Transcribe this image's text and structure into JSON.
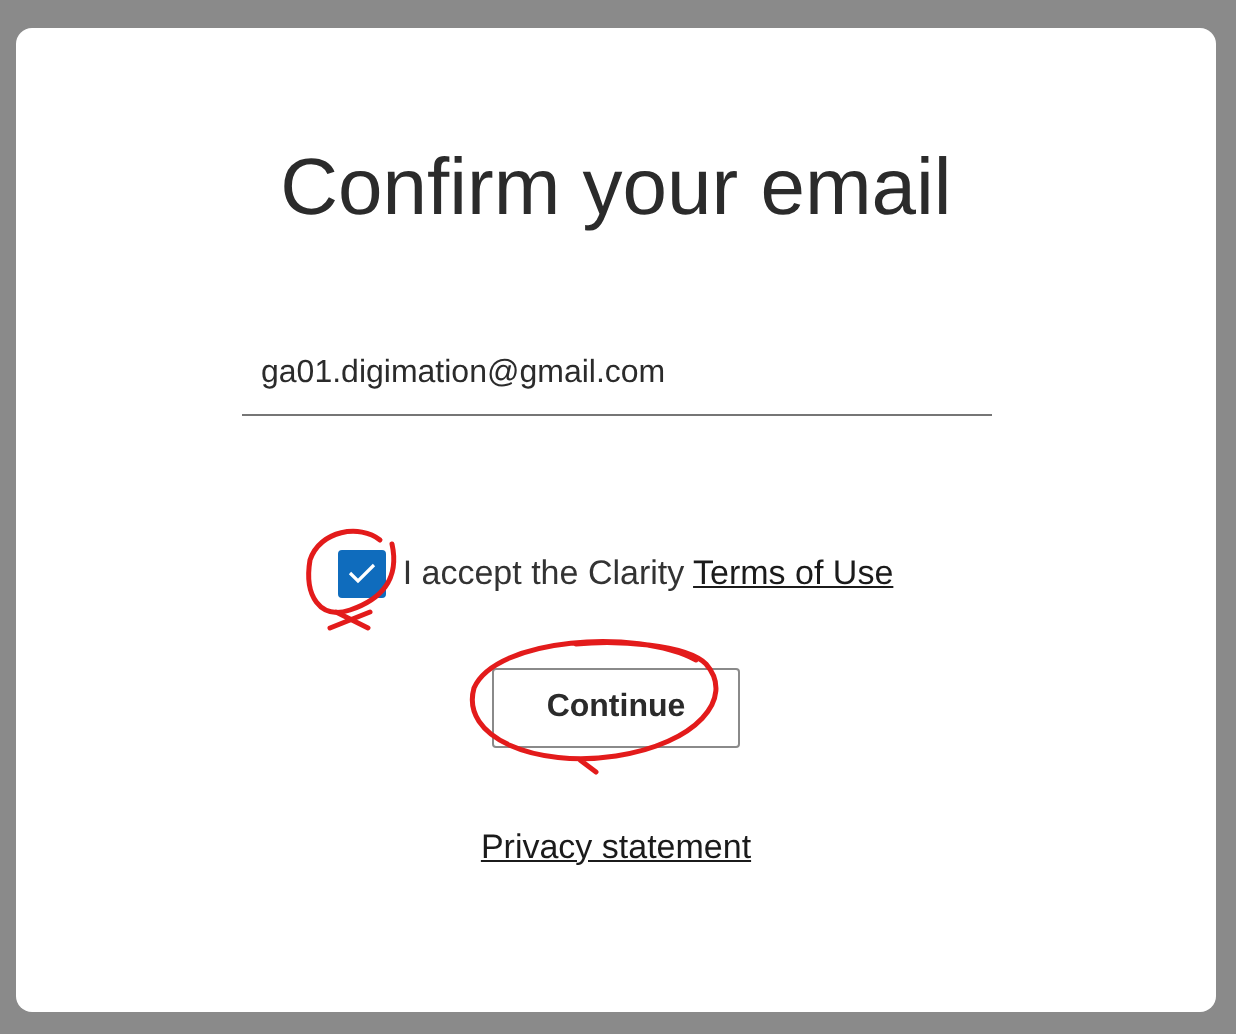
{
  "dialog": {
    "title": "Confirm your email",
    "email": {
      "value": "ga01.digimation@gmail.com"
    },
    "terms": {
      "text": "I accept the Clarity",
      "link": "Terms of Use",
      "checked": true,
      "circled": true
    },
    "button": {
      "label": "Continue",
      "circled": true
    },
    "footer_link": "Privacy statement"
  }
}
